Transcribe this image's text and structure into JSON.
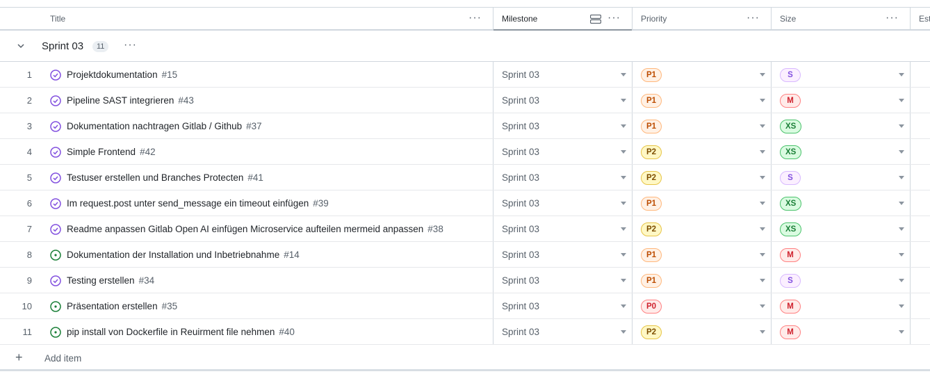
{
  "columns": {
    "title": "Title",
    "milestone": "Milestone",
    "priority": "Priority",
    "size": "Size",
    "estimate": "Est"
  },
  "group": {
    "name": "Sprint 03",
    "count": "11"
  },
  "rows": [
    {
      "num": "1",
      "status": "closed",
      "title": "Projektdokumentation",
      "issue": "#15",
      "milestone": "Sprint 03",
      "priority": "P1",
      "size": "S"
    },
    {
      "num": "2",
      "status": "closed",
      "title": "Pipeline SAST integrieren",
      "issue": "#43",
      "milestone": "Sprint 03",
      "priority": "P1",
      "size": "M"
    },
    {
      "num": "3",
      "status": "closed",
      "title": "Dokumentation nachtragen Gitlab / Github",
      "issue": "#37",
      "milestone": "Sprint 03",
      "priority": "P1",
      "size": "XS"
    },
    {
      "num": "4",
      "status": "closed",
      "title": "Simple Frontend",
      "issue": "#42",
      "milestone": "Sprint 03",
      "priority": "P2",
      "size": "XS"
    },
    {
      "num": "5",
      "status": "closed",
      "title": "Testuser erstellen und Branches Protecten",
      "issue": "#41",
      "milestone": "Sprint 03",
      "priority": "P2",
      "size": "S"
    },
    {
      "num": "6",
      "status": "closed",
      "title": "Im request.post unter send_message ein timeout einfügen",
      "issue": "#39",
      "milestone": "Sprint 03",
      "priority": "P1",
      "size": "XS"
    },
    {
      "num": "7",
      "status": "closed",
      "title": "Readme anpassen Gitlab Open AI einfügen Microservice aufteilen mermeid anpassen",
      "issue": "#38",
      "milestone": "Sprint 03",
      "priority": "P2",
      "size": "XS"
    },
    {
      "num": "8",
      "status": "open",
      "title": "Dokumentation der Installation und Inbetriebnahme",
      "issue": "#14",
      "milestone": "Sprint 03",
      "priority": "P1",
      "size": "M"
    },
    {
      "num": "9",
      "status": "closed",
      "title": "Testing erstellen",
      "issue": "#34",
      "milestone": "Sprint 03",
      "priority": "P1",
      "size": "S"
    },
    {
      "num": "10",
      "status": "open",
      "title": "Präsentation erstellen",
      "issue": "#35",
      "milestone": "Sprint 03",
      "priority": "P0",
      "size": "M"
    },
    {
      "num": "11",
      "status": "open",
      "title": "pip install von Dockerfile in Reuirment file nehmen",
      "issue": "#40",
      "milestone": "Sprint 03",
      "priority": "P2",
      "size": "M"
    }
  ],
  "add_item": {
    "label": "Add item"
  },
  "colors": {
    "closed_icon": "#8250df",
    "open_icon": "#1a7f37",
    "P0": {
      "bg": "#ffebe9",
      "border": "#ff8182",
      "text": "#cf222e"
    },
    "P1": {
      "bg": "#fff1e5",
      "border": "#ffb77c",
      "text": "#bc4c00"
    },
    "P2": {
      "bg": "#fff8c5",
      "border": "#e6c446",
      "text": "#7d4e00"
    },
    "S": {
      "bg": "#fbefff",
      "border": "#d8b9ff",
      "text": "#8250df"
    },
    "M": {
      "bg": "#ffebe9",
      "border": "#ff8182",
      "text": "#cf222e"
    },
    "XS": {
      "bg": "#dafbe1",
      "border": "#4ac26b",
      "text": "#1a7f37"
    }
  }
}
